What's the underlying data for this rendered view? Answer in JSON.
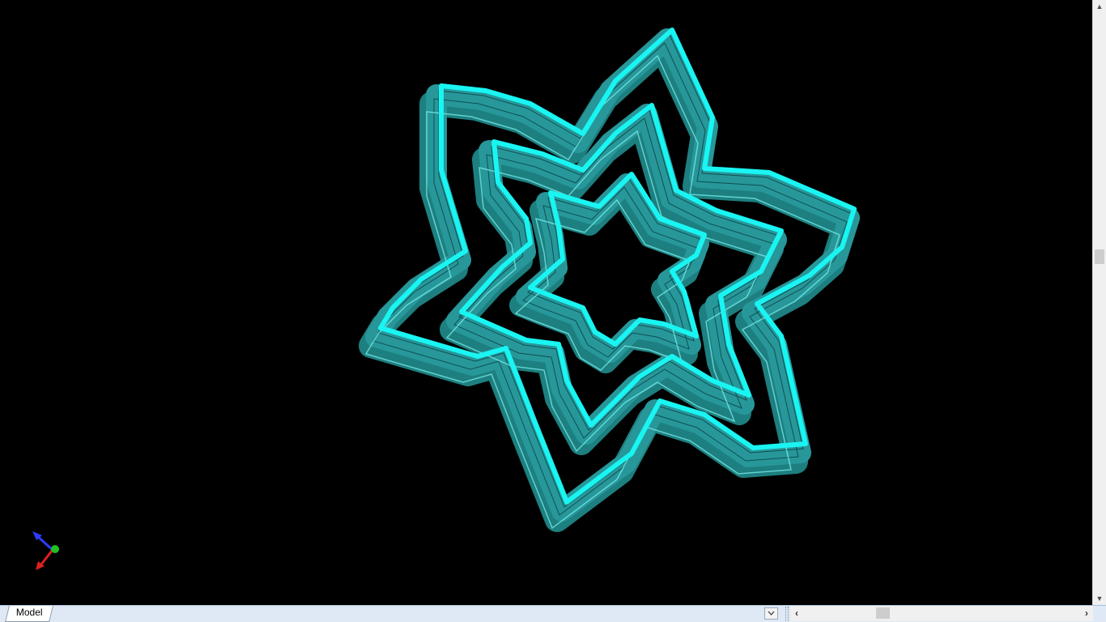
{
  "sheet_tabs": [
    {
      "label": "Model"
    }
  ],
  "tab_menu_icon": "chevron-down-icon",
  "scroll": {
    "left_icon": "‹",
    "right_icon": "›",
    "up_icon": "▲",
    "down_icon": "▼"
  },
  "viewport": {
    "background": "#000000",
    "model": {
      "shape": "six-pointed star with three nested wavy outlines",
      "face_color": "#1f8a8a",
      "edge_highlight_color": "#19f5f2"
    },
    "triad": {
      "axis_colors": [
        "#2d3cff",
        "#e02020",
        "#20c020"
      ]
    }
  }
}
